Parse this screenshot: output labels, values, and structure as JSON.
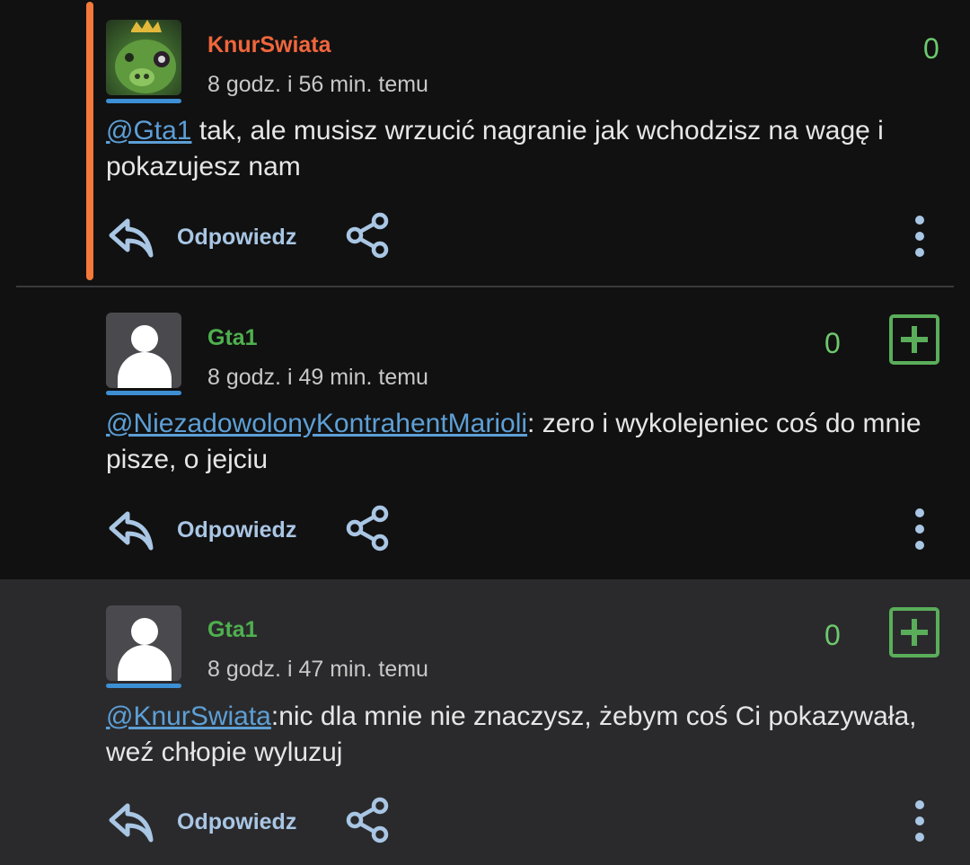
{
  "comments": [
    {
      "username": "KnurSwiata",
      "time": "8 godz. i 56 min. temu",
      "score": "0",
      "mention": "@Gta1",
      "text": " tak, ale musisz wrzucić nagranie jak wchodzisz na wagę i pokazujesz nam",
      "reply_label": "Odpowiedz"
    },
    {
      "username": "Gta1",
      "time": "8 godz. i 49 min. temu",
      "score": "0",
      "mention": "@NiezadowolonyKontrahentMarioli",
      "text": ": zero i wykolejeniec coś do mnie pisze, o jejciu",
      "reply_label": "Odpowiedz"
    },
    {
      "username": "Gta1",
      "time": "8 godz. i 47 min. temu",
      "score": "0",
      "mention": "@KnurSwiata",
      "text": ":nic dla mnie nie znaczysz, żebym coś Ci pokazywała, weź chłopie wyluzuj",
      "reply_label": "Odpowiedz"
    }
  ],
  "colors": {
    "accent": "#f4793a",
    "username_red": "#f0663c",
    "username_green": "#4fb04f",
    "score_green": "#6dc96d",
    "mention_blue": "#5d9fd6",
    "action_blue": "#a9c6e4"
  },
  "icons": {
    "reply": "reply-arrow-icon",
    "share": "share-icon",
    "more": "more-vertical-icon",
    "plus": "plus-box-icon"
  }
}
